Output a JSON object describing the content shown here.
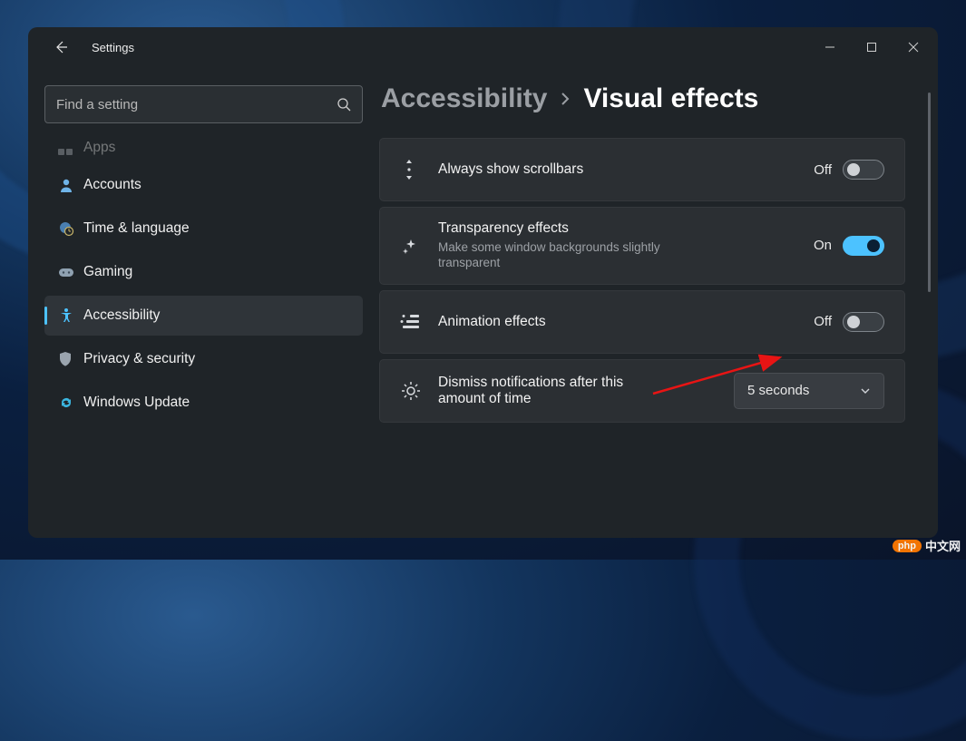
{
  "app": {
    "title": "Settings"
  },
  "search": {
    "placeholder": "Find a setting"
  },
  "sidebar": {
    "items": [
      {
        "label": "Apps",
        "icon": "apps",
        "cut_top": true
      },
      {
        "label": "Accounts",
        "icon": "person"
      },
      {
        "label": "Time & language",
        "icon": "clock-globe"
      },
      {
        "label": "Gaming",
        "icon": "gamepad"
      },
      {
        "label": "Accessibility",
        "icon": "accessibility",
        "active": true
      },
      {
        "label": "Privacy & security",
        "icon": "shield"
      },
      {
        "label": "Windows Update",
        "icon": "sync"
      }
    ]
  },
  "breadcrumb": {
    "parent": "Accessibility",
    "current": "Visual effects"
  },
  "settings": [
    {
      "key": "scrollbars",
      "title": "Always show scrollbars",
      "desc": "",
      "value_label": "Off",
      "toggle": false,
      "icon": "scroll-v"
    },
    {
      "key": "transparency",
      "title": "Transparency effects",
      "desc": "Make some window backgrounds slightly transparent",
      "value_label": "On",
      "toggle": true,
      "icon": "sparkle"
    },
    {
      "key": "animation",
      "title": "Animation effects",
      "desc": "",
      "value_label": "Off",
      "toggle": false,
      "icon": "motion-list"
    },
    {
      "key": "dismiss",
      "title": "Dismiss notifications after this amount of time",
      "desc": "",
      "control": "dropdown",
      "dropdown_value": "5 seconds",
      "icon": "brightness"
    }
  ],
  "watermark": {
    "badge": "php",
    "text": "中文网"
  }
}
